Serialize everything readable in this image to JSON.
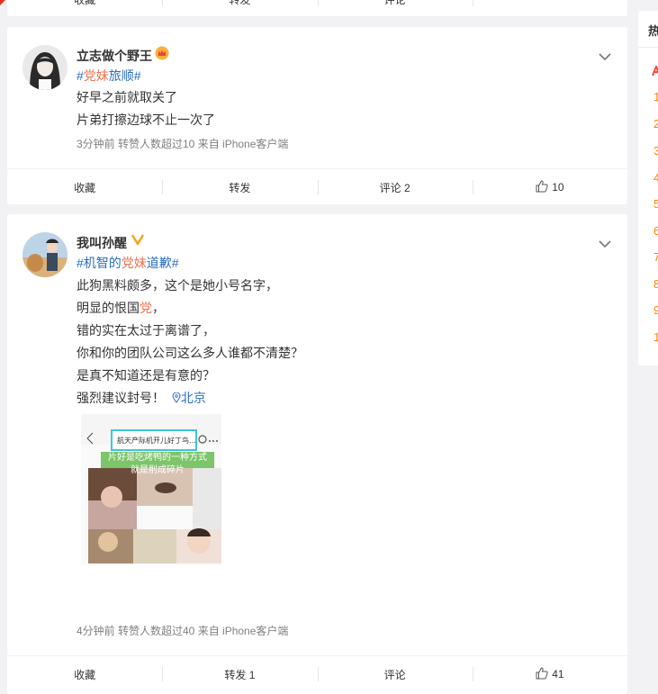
{
  "top_partial_actions": [
    "收藏",
    "转发",
    "评论",
    ""
  ],
  "posts": [
    {
      "username": "立志做个野王",
      "badge": "crown-badge-icon",
      "hashtag": {
        "pre": "#",
        "red": "党妹",
        "blue": "旅顺",
        "post": "#"
      },
      "lines": [
        "好早之前就取关了",
        "片弟打擦边球不止一次了"
      ],
      "meta": "3分钟前 转赞人数超过10 来自 iPhone客户端",
      "actions": {
        "collect": "收藏",
        "repost": "转发",
        "comment": "评论 2",
        "like": "10"
      }
    },
    {
      "username": "我叫孙醒",
      "badge": "verified-v-icon",
      "hashtag": {
        "pre": "#机智的",
        "red": "党妹",
        "blue": "道歉",
        "post": "#"
      },
      "lines": [
        "此狗黑料颇多，这个是她小号名字，",
        "明显的恨国",
        "错的实在太过于离谱了，",
        "你和你的团队公司这么多人谁都不清楚？",
        "是真不知道还是有意的？",
        "强烈建议封号！"
      ],
      "line2_red": "党",
      "line2_end": "，",
      "location": "北京",
      "image": {
        "search_text": "航天产际机开儿好丁鸟…",
        "caption_line1": "片好是吃烤鸭的一种方式",
        "caption_line2": "就是削成碎片"
      },
      "meta": "4分钟前 转赞人数超过40 来自 iPhone客户端",
      "actions": {
        "collect": "收藏",
        "repost": "转发 1",
        "comment": "评论",
        "like": "41"
      }
    }
  ],
  "sidebar": {
    "title_fragment": "热",
    "ranks": [
      "1",
      "2",
      "3",
      "4",
      "5",
      "6",
      "7",
      "8",
      "9",
      "1"
    ]
  },
  "colors": {
    "accent": "#eb7350",
    "link": "#2a6cbf",
    "orange": "#ff8200",
    "verified": "#f5a623"
  }
}
